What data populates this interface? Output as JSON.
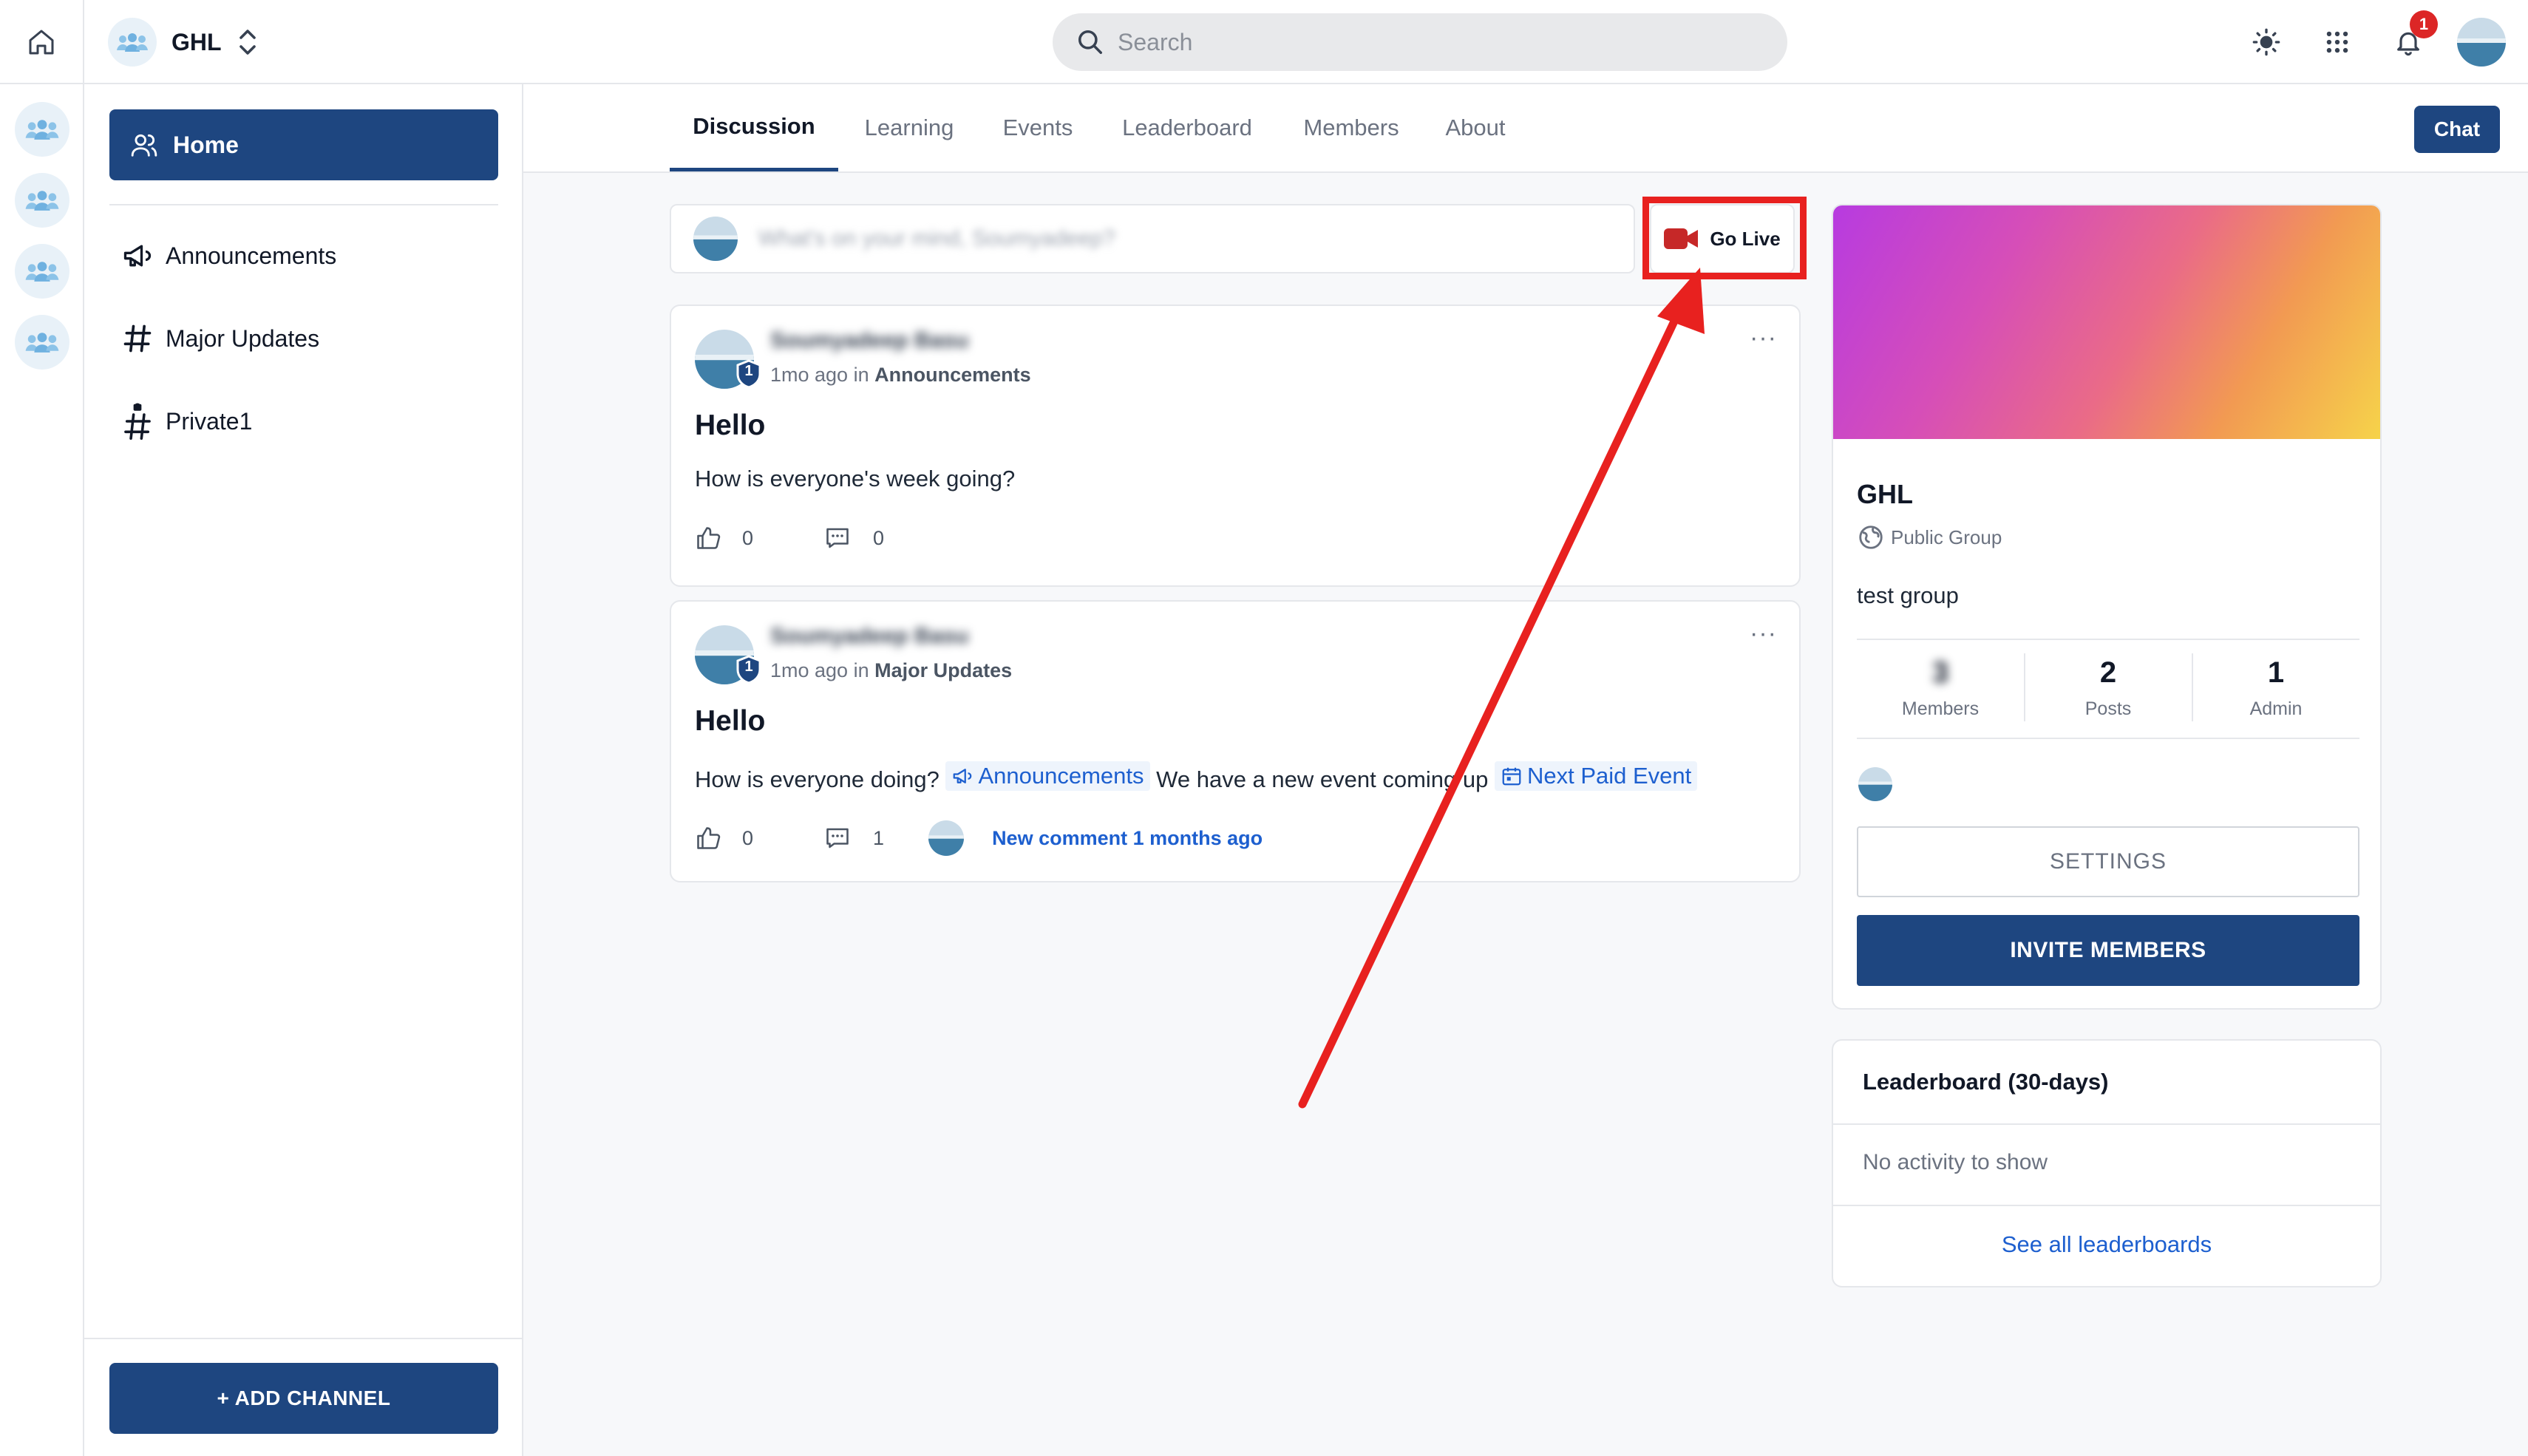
{
  "topbar": {
    "group_name": "GHL",
    "search_placeholder": "Search",
    "notification_count": "1"
  },
  "sidebar": {
    "home_label": "Home",
    "channels": [
      {
        "label": "Announcements",
        "icon": "megaphone-icon"
      },
      {
        "label": "Major Updates",
        "icon": "hashtag-icon"
      },
      {
        "label": "Private1",
        "icon": "locked-hashtag-icon"
      }
    ],
    "add_channel_label": "+ ADD CHANNEL"
  },
  "tabs": [
    "Discussion",
    "Learning",
    "Events",
    "Leaderboard",
    "Members",
    "About"
  ],
  "active_tab": "Discussion",
  "chat_label": "Chat",
  "composer": {
    "placeholder": "What's on your mind, Soumyadeep?",
    "go_live_label": "Go Live"
  },
  "posts": [
    {
      "author": "Soumyadeep Basu",
      "level": "1",
      "time": "1mo ago",
      "in_word": "in",
      "channel": "Announcements",
      "title": "Hello",
      "body": "How is everyone's week going?",
      "likes": "0",
      "comments": "0"
    },
    {
      "author": "Soumyadeep Basu",
      "level": "1",
      "time": "1mo ago",
      "in_word": "in",
      "channel": "Major Updates",
      "title": "Hello",
      "body_part1": "How is everyone doing?",
      "mention1": "Announcements",
      "body_part2": "We have a new event coming up",
      "mention2": "Next Paid Event",
      "likes": "0",
      "comments": "1",
      "new_comment": "New comment 1 months ago"
    }
  ],
  "group_card": {
    "name": "GHL",
    "type": "Public Group",
    "description": "test group",
    "stats": [
      {
        "value": "3",
        "label": "Members"
      },
      {
        "value": "2",
        "label": "Posts"
      },
      {
        "value": "1",
        "label": "Admin"
      }
    ],
    "settings_label": "SETTINGS",
    "invite_label": "INVITE MEMBERS"
  },
  "leaderboard": {
    "title": "Leaderboard (30-days)",
    "empty_text": "No activity to show",
    "link_label": "See all leaderboards"
  },
  "colors": {
    "primary": "#1e4680",
    "link": "#1d5fcf",
    "annotation": "#e8211f",
    "notification": "#dc2626"
  }
}
